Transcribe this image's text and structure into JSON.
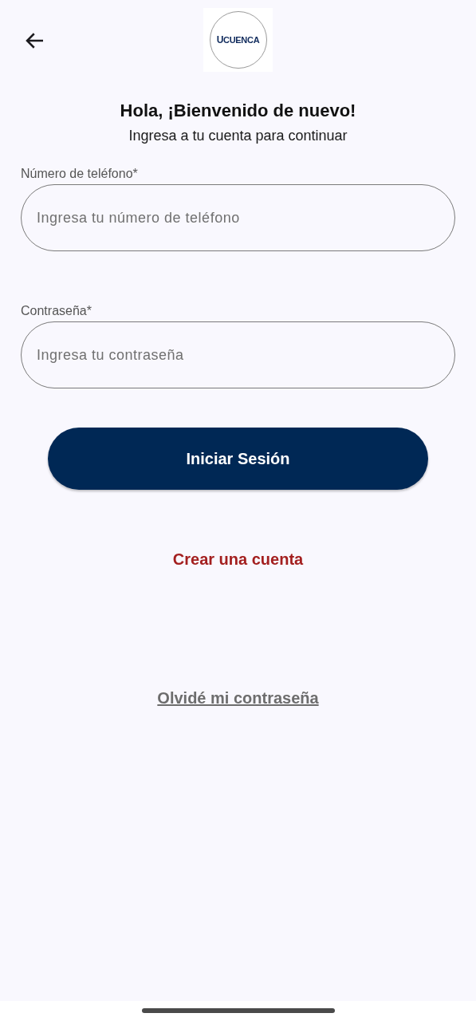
{
  "logo": {
    "text": "**U**CUENCA"
  },
  "title": "Hola, ¡Bienvenido de nuevo!",
  "subtitle": "Ingresa a tu cuenta para continuar",
  "fields": [
    {
      "label": "Número de teléfono*",
      "placeholder": "Ingresa tu número de teléfono"
    },
    {
      "label": "Contraseña*",
      "placeholder": "Ingresa tu contraseña"
    }
  ],
  "login_button": "Iniciar Sesión",
  "create_account_link": "Crear una cuenta",
  "forgot_password_link": "Olvidé mi contraseña"
}
